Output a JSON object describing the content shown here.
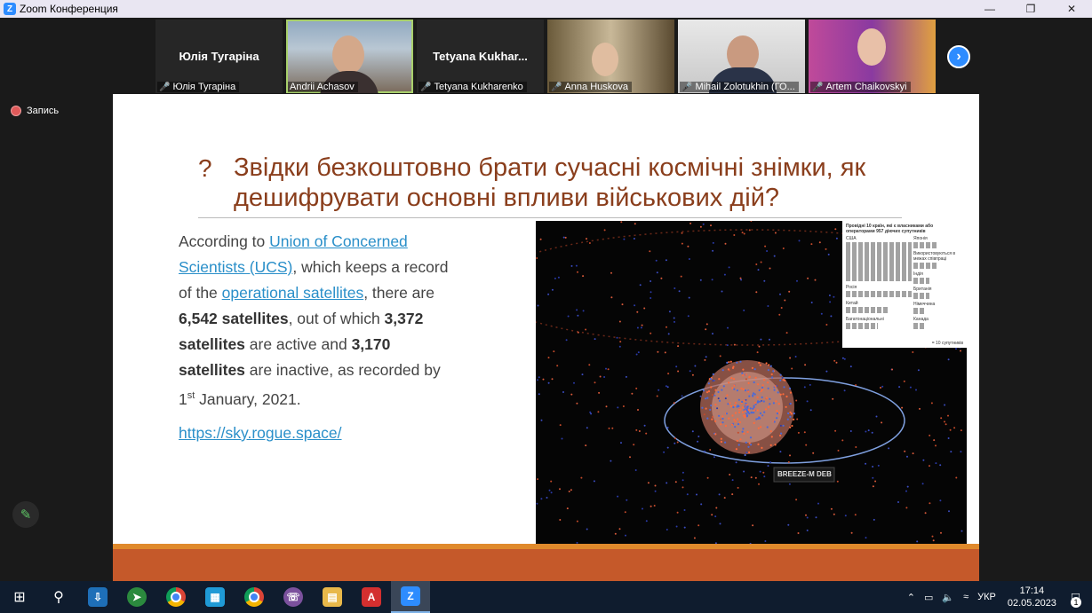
{
  "window": {
    "title": "Zoom Конференция",
    "app_icon": "zoom-icon"
  },
  "gallery": {
    "participants": [
      {
        "big_name": "Юлія Тугаріна",
        "label": "Юлія Тугаріна",
        "muted": true
      },
      {
        "big_name": "",
        "label": "Andrii Achasov",
        "muted": false
      },
      {
        "big_name": "Tetyana  Kukhar...",
        "label": "Tetyana Kukharenko",
        "muted": true
      },
      {
        "big_name": "",
        "label": "Anna Huskova",
        "muted": true
      },
      {
        "big_name": "",
        "label": "Mihail Zolotukhin (ГО...",
        "muted": true
      },
      {
        "big_name": "",
        "label": "Artem Chaikovskyi",
        "muted": true
      }
    ],
    "next_icon": "chevron-right-icon"
  },
  "recording": {
    "label": "Запись"
  },
  "slide": {
    "question_mark": "?",
    "title": "Звідки безкоштовно брати сучасні космічні знімки, як дешифрувати основні впливи військових дій?",
    "body": {
      "p1": "According to ",
      "link1": "Union of Concerned Scientists (UCS)",
      "p2": ", which keeps a record of the ",
      "link2": "operational satellites",
      "p3": ", there are ",
      "b1": "6,542 satellites",
      "p4": ", out of which ",
      "b2": "3,372 satellites",
      "p5": " are active and ",
      "b3": "3,170 satellites",
      "p6": " are inactive, as recorded by 1",
      "sup": "st",
      "p7": " January, 2021."
    },
    "url": "https://sky.rogue.space/",
    "space_label": "BREEZE-M DEB",
    "inset": {
      "header": "Провідні 10 країн, які є власниками або операторами 957 діючих супутників",
      "left": [
        {
          "name": "США",
          "rows": 5
        },
        {
          "name": "Росія",
          "rows": 1
        },
        {
          "name": "Китай",
          "rows": 1
        },
        {
          "name": "Багатонаціональні",
          "rows": 1
        }
      ],
      "right": [
        {
          "name": "Японія",
          "rows": 1
        },
        {
          "name": "Використовуються в межах співпраці",
          "rows": 1
        },
        {
          "name": "Індія",
          "rows": 1
        },
        {
          "name": "Британія",
          "rows": 1
        },
        {
          "name": "Німеччина",
          "rows": 1
        },
        {
          "name": "Канада",
          "rows": 1
        }
      ],
      "legend": "= 10 супутників"
    }
  },
  "taskbar": {
    "apps": [
      "start",
      "search",
      "app-download",
      "app-green",
      "chrome",
      "store",
      "chrome-profile",
      "viber",
      "explorer",
      "acrobat",
      "zoom"
    ],
    "tray": {
      "language": "УКР",
      "time": "17:14",
      "date": "02.05.2023",
      "notifications": "1"
    }
  },
  "colors": {
    "title": "#8a3e1c",
    "link": "#2a8fc9",
    "footer_orange": "#e08a2c",
    "footer_red": "#c5592a",
    "zoom_blue": "#2d8cff"
  }
}
